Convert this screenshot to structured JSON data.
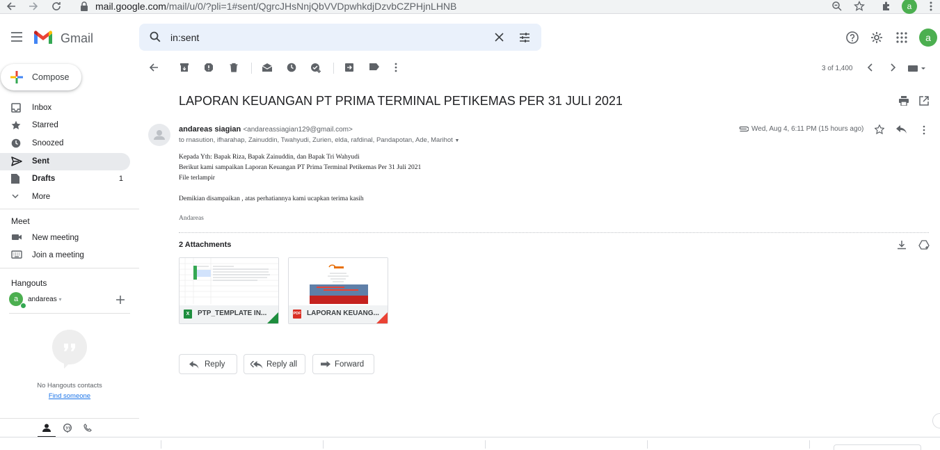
{
  "browser": {
    "url_host": "mail.google.com",
    "url_path": "/mail/u/0/?pli=1#sent/QgrcJHsNnjQbVVDpwhkdjDzvbCZPHjnLHNB",
    "profile_initial": "a"
  },
  "header": {
    "app_name": "Gmail",
    "search_value": "in:sent",
    "account_initial": "a"
  },
  "sidebar": {
    "compose_label": "Compose",
    "items": [
      {
        "label": "Inbox",
        "icon": "inbox-icon",
        "active": false,
        "count": ""
      },
      {
        "label": "Starred",
        "icon": "star-icon",
        "active": false,
        "count": ""
      },
      {
        "label": "Snoozed",
        "icon": "clock-icon",
        "active": false,
        "count": ""
      },
      {
        "label": "Sent",
        "icon": "send-icon",
        "active": true,
        "count": ""
      },
      {
        "label": "Drafts",
        "icon": "draft-icon",
        "active": false,
        "count": "1"
      },
      {
        "label": "More",
        "icon": "chevron-down-icon",
        "active": false,
        "count": ""
      }
    ],
    "meet": {
      "title": "Meet",
      "new_meeting": "New meeting",
      "join_meeting": "Join a meeting"
    },
    "hangouts": {
      "title": "Hangouts",
      "user": "andareas",
      "user_initial": "a",
      "no_contacts": "No Hangouts contacts",
      "find_someone": "Find someone"
    }
  },
  "toolbar": {
    "pager": "3 of 1,400"
  },
  "email": {
    "subject": "LAPORAN KEUANGAN PT PRIMA TERMINAL PETIKEMAS PER 31 JULI 2021",
    "sender_name": "andareas siagian",
    "sender_email": "<andareassiagian129@gmail.com>",
    "recipients": "to rnasution, ifharahap, Zainuddin, Twahyudi, Zurien, elda, rafdinal, Pandapotan, Ade, Marihot",
    "datetime": "Wed, Aug 4, 6:11 PM (15 hours ago)",
    "body_lines": [
      "Kepada Yth: Bapak Riza, Bapak Zainuddin, dan Bapak Tri Wahyudi",
      "Berikut kami sampaikan Laporan Keuangan PT Prima Terminal Petikemas Per 31 Juli 2021",
      "File terlampir",
      "",
      "Demikian disampaikan , atas perhatiannya kami ucapkan terima kasih"
    ],
    "signature": "Andareas",
    "attachments_title": "2 Attachments",
    "attachments": [
      {
        "name": "PTP_TEMPLATE IN...",
        "type": "X",
        "type_color": "#1e8e3e"
      },
      {
        "name": "LAPORAN KEUANG...",
        "type": "PDF",
        "type_color": "#d93025"
      }
    ],
    "reply_label": "Reply",
    "reply_all_label": "Reply all",
    "forward_label": "Forward"
  }
}
